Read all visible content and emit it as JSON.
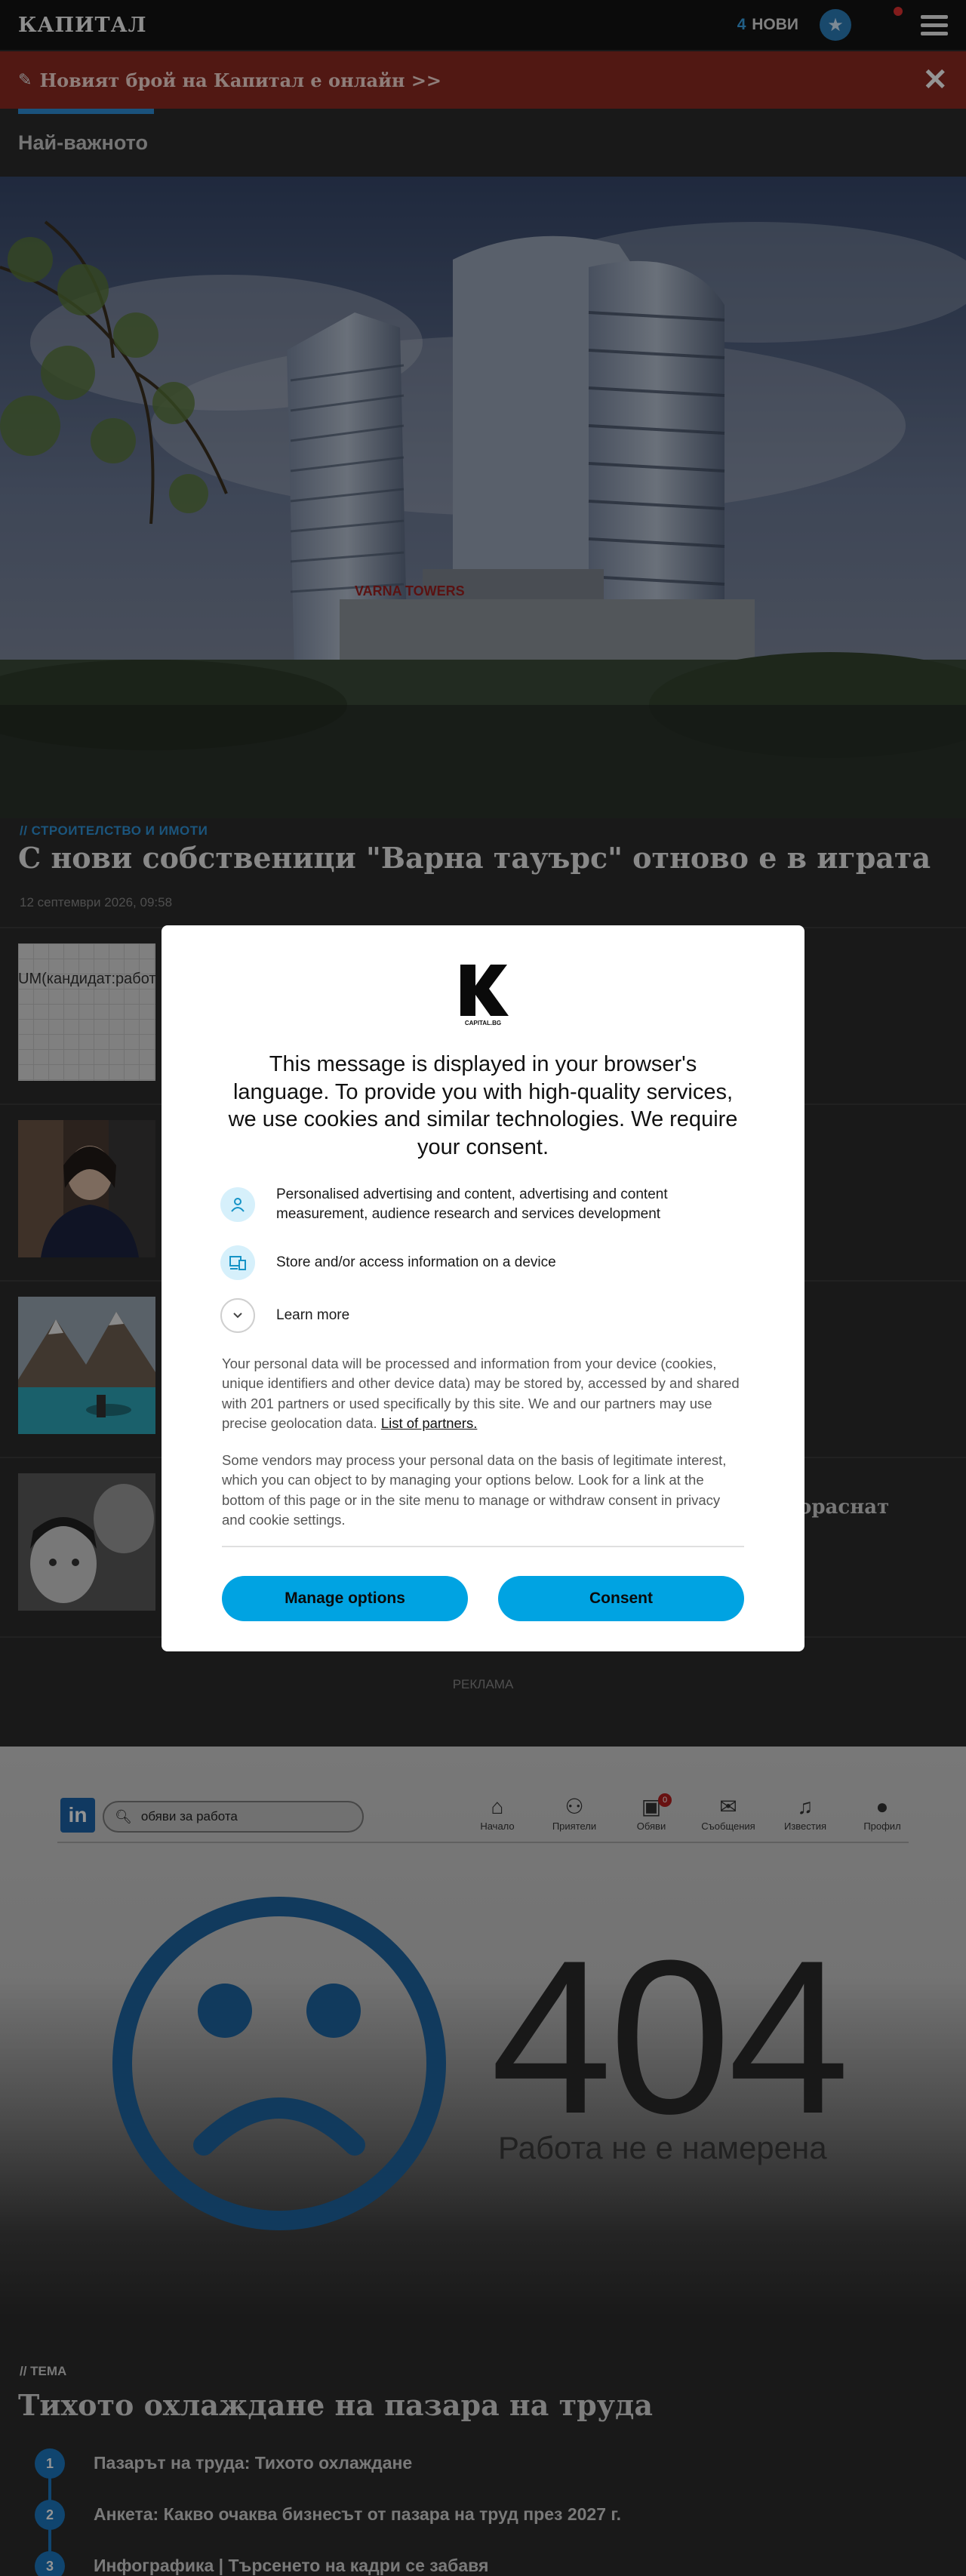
{
  "header": {
    "logo": "КАПИТАЛ",
    "new_count": "4",
    "new_label": "НОВИ"
  },
  "banner": {
    "text": "Новият брой на Капитал е онлайн >>"
  },
  "section": {
    "title": "Най-важното"
  },
  "hero": {
    "category": "// СТРОИТЕЛСТВО И ИМОТИ",
    "title": "С нови собственици \"Варна тауърс\" отново е в играта",
    "date": "12 септември 2026, 09:58",
    "sign": "VARNA TOWERS"
  },
  "articles": [
    {
      "thumb_text": "UM(кандидат:работ",
      "title": ""
    },
    {
      "title": ""
    },
    {
      "title": ""
    },
    {
      "title": "орасн­ат"
    }
  ],
  "ad": {
    "label": "РЕКЛАМА"
  },
  "ad_image": {
    "logo": "in",
    "search_text": "обяви за работа",
    "nav": [
      {
        "label": "Начало",
        "icon": "home-icon"
      },
      {
        "label": "Приятели",
        "icon": "people-icon"
      },
      {
        "label": "Обяви",
        "icon": "briefcase-icon",
        "badge": "0"
      },
      {
        "label": "Съобщения",
        "icon": "chat-icon"
      },
      {
        "label": "Известия",
        "icon": "bell-icon"
      },
      {
        "label": "Профил",
        "icon": "profile-icon"
      }
    ],
    "code": "404",
    "message": "Работа не е намерена"
  },
  "tema": {
    "category": "// ТЕМА",
    "title": "Тихото охлаждане на пазара на труда",
    "items": [
      {
        "num": "1",
        "text": "Пазарът на труда: Тихото охлаждане"
      },
      {
        "num": "2",
        "text": "Анкета: Какво очаква бизнесът от пазара на труд през 2027 г."
      },
      {
        "num": "3",
        "text": "Инфографика | Търсенето на кадри се забавя"
      }
    ]
  },
  "consent": {
    "logo_sub": "CAPITAL.BG",
    "heading": "This message is displayed in your browser's language. To provide you with high-quality services, we use cookies and similar technologies. We require your consent.",
    "purposes": [
      {
        "text": "Personalised advertising and content, advertising and content measurement, audience research and services development",
        "icon": "person-icon"
      },
      {
        "text": "Store and/or access information on a device",
        "icon": "devices-icon"
      },
      {
        "text": "Learn more",
        "icon": "chevron-down-icon"
      }
    ],
    "para1": "Your personal data will be processed and information from your device (cookies, unique identifiers and other device data) may be stored by, accessed by and shared with 201 partners or used specifically by this site. We and our partners may use precise geolocation data.",
    "partners_link": "List of partners.",
    "para2": "Some vendors may process your personal data on the basis of legitimate interest, which you can object to by managing your options below. Look for a link at the bottom of this page or in the site menu to manage or withdraw consent in privacy and cookie settings.",
    "manage_label": "Manage options",
    "consent_label": "Consent"
  }
}
